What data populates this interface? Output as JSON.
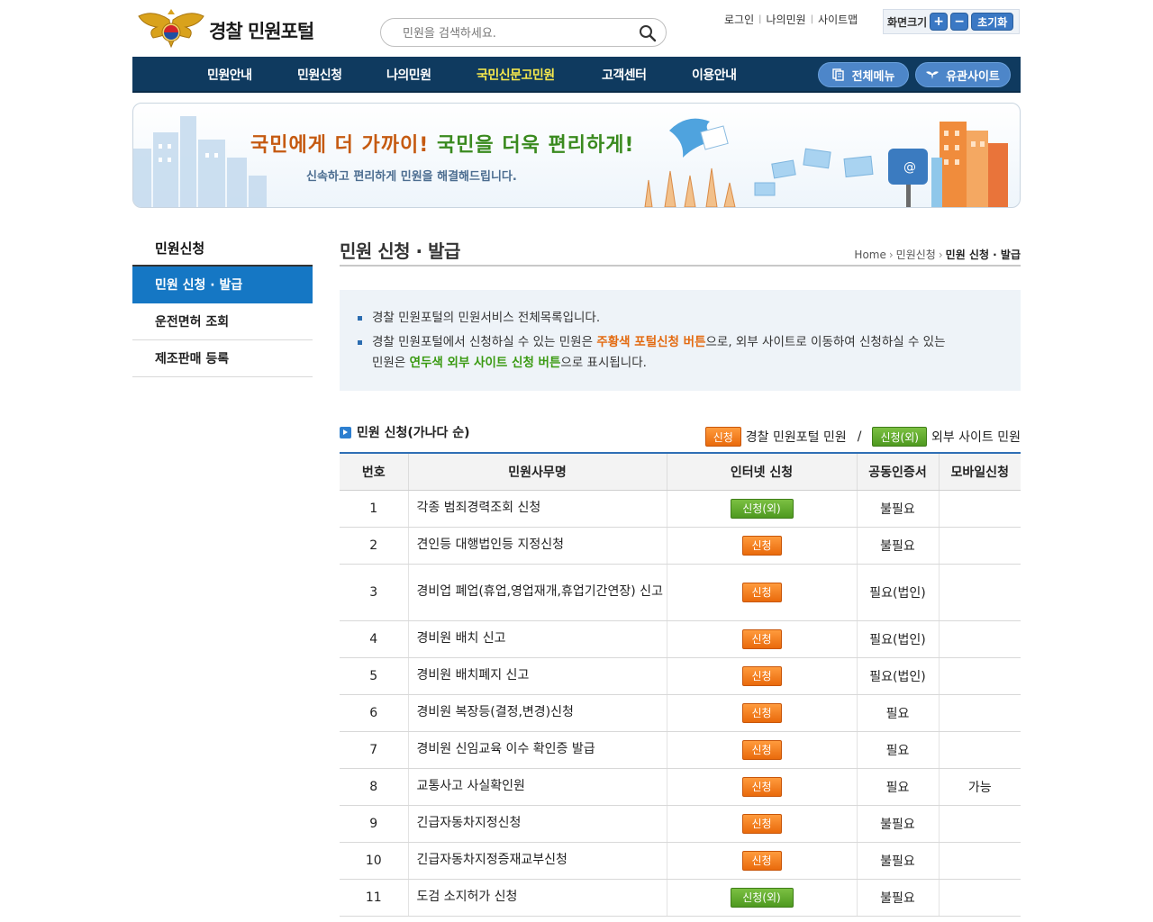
{
  "header": {
    "logo_text": "경찰 민원포털",
    "search": {
      "placeholder": "민원을 검색하세요."
    },
    "util_links": [
      "로그인",
      "나의민원",
      "사이트맵"
    ],
    "font_size": {
      "label": "화면크기",
      "plus": "+",
      "minus": "−",
      "reset": "초기화"
    }
  },
  "nav": {
    "items": [
      "민원안내",
      "민원신청",
      "나의민원",
      "국민신문고민원",
      "고객센터",
      "이용안내"
    ],
    "active_index": 3,
    "all_menu": "전체메뉴",
    "related_sites": "유관사이트"
  },
  "banner": {
    "headline_a": "국민에게 더 가까이!",
    "headline_b": "국민을 더욱 편리하게!",
    "sub": "신속하고 편리하게 민원을 해결해드립니다."
  },
  "lnb": {
    "title": "민원신청",
    "items": [
      "민원 신청 · 발급",
      "운전면허 조회",
      "제조판매 등록"
    ],
    "active_index": 0
  },
  "content": {
    "page_title": "민원 신청 · 발급",
    "breadcrumb": {
      "home": "Home",
      "section": "민원신청",
      "current": "민원 신청 · 발급"
    },
    "notice": {
      "line1": "경찰 민원포털의 민원서비스 전체목록입니다.",
      "line2_pre": "경찰 민원포털에서 신청하실 수 있는 민원은 ",
      "line2_orange": "주황색 포털신청 버튼",
      "line2_mid": "으로, 외부 사이트로 이동하여 신청하실 수 있는",
      "line3_pre": "민원은 ",
      "line3_green": "연두색 외부 사이트 신청 버튼",
      "line3_post": "으로 표시됩니다."
    },
    "list_title": "민원 신청(가나다 순)",
    "legend": {
      "portal_tag": "신청",
      "portal_text": "경찰 민원포털 민원",
      "slash": "/",
      "external_tag": "신청(외)",
      "external_text": "외부 사이트 민원"
    },
    "table": {
      "headers": [
        "번호",
        "민원사무명",
        "인터넷 신청",
        "공동인증서",
        "모바일신청"
      ],
      "rows": [
        {
          "no": "1",
          "name": "각종 범죄경력조회 신청",
          "button": "신청(외)",
          "type": "green",
          "cert": "불필요",
          "mobile": ""
        },
        {
          "no": "2",
          "name": "견인등 대행법인등 지정신청",
          "button": "신청",
          "type": "orange",
          "cert": "불필요",
          "mobile": ""
        },
        {
          "no": "3",
          "name": "경비업 폐업(휴업,영업재개,휴업기간연장) 신고",
          "button": "신청",
          "type": "orange",
          "cert": "필요(법인)",
          "mobile": ""
        },
        {
          "no": "4",
          "name": "경비원 배치 신고",
          "button": "신청",
          "type": "orange",
          "cert": "필요(법인)",
          "mobile": ""
        },
        {
          "no": "5",
          "name": "경비원 배치폐지 신고",
          "button": "신청",
          "type": "orange",
          "cert": "필요(법인)",
          "mobile": ""
        },
        {
          "no": "6",
          "name": "경비원 복장등(결정,변경)신청",
          "button": "신청",
          "type": "orange",
          "cert": "필요",
          "mobile": ""
        },
        {
          "no": "7",
          "name": "경비원 신임교육 이수 확인증 발급",
          "button": "신청",
          "type": "orange",
          "cert": "필요",
          "mobile": ""
        },
        {
          "no": "8",
          "name": "교통사고 사실확인원",
          "button": "신청",
          "type": "orange",
          "cert": "필요",
          "mobile": "가능"
        },
        {
          "no": "9",
          "name": "긴급자동차지정신청",
          "button": "신청",
          "type": "orange",
          "cert": "불필요",
          "mobile": ""
        },
        {
          "no": "10",
          "name": "긴급자동차지정증재교부신청",
          "button": "신청",
          "type": "orange",
          "cert": "불필요",
          "mobile": ""
        },
        {
          "no": "11",
          "name": "도검 소지허가 신청",
          "button": "신청(외)",
          "type": "green",
          "cert": "불필요",
          "mobile": ""
        }
      ]
    }
  },
  "colors": {
    "nav_bg": "#0f3a5f",
    "nav_active": "#f6e84d",
    "accent_blue": "#1577c4",
    "orange": "#e96a0c",
    "green": "#4e9920"
  }
}
